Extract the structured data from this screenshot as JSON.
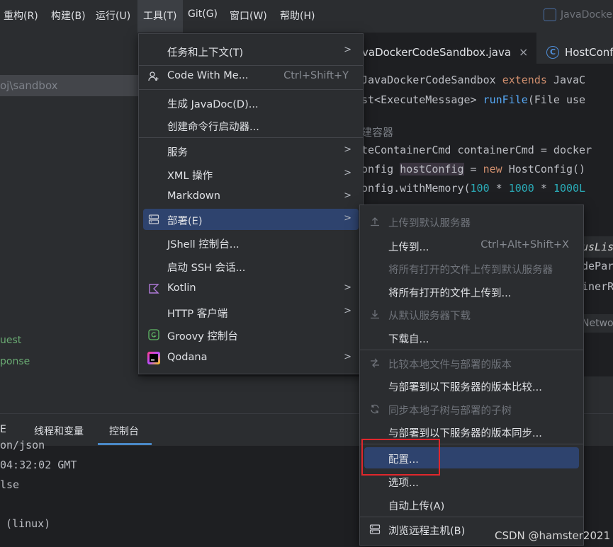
{
  "menubar": {
    "items": [
      "重构(R)",
      "构建(B)",
      "运行(U)",
      "工具(T)",
      "Git(G)",
      "窗口(W)",
      "帮助(H)"
    ],
    "window_title": "JavaDocker"
  },
  "project": {
    "path_fragment": "oj\\sandbox",
    "items": [
      "uest",
      "ponse"
    ]
  },
  "editor": {
    "tabs": [
      {
        "label": "vaDockerCodeSandbox.java",
        "close": "×",
        "active": true
      },
      {
        "label": "HostConf",
        "icon": "C"
      }
    ],
    "lines": [
      {
        "kind": "c1",
        "a": "JavaDockerCodeSandbox ",
        "b": "extends ",
        "c": "JavaC"
      },
      {
        "kind": "c2",
        "a": "st<ExecuteMessage> ",
        "b": "runFile",
        "c": "(File use"
      },
      {
        "kind": "comment",
        "a": "建容器"
      },
      {
        "kind": "plain",
        "a": "teContainerCmd containerCmd = docker"
      },
      {
        "kind": "c3",
        "a": "onfig ",
        "b": "hostConfig",
        "c": " = ",
        "d": "new ",
        "e": "HostConfig()"
      },
      {
        "kind": "c4",
        "a": "onfig.withMemory(",
        "b": "100",
        "c": " * ",
        "d": "1000",
        "e": " * ",
        "f": "1000L"
      },
      {
        "kind": "frag",
        "a": "usLis"
      },
      {
        "kind": "frag",
        "a": "dePar"
      },
      {
        "kind": "frag",
        "a": "inerR"
      },
      {
        "kind": "frag",
        "a": "Netwo"
      }
    ]
  },
  "bottom": {
    "tabs": [
      "E",
      "线程和变量",
      "控制台"
    ],
    "console": [
      "on/json",
      "04:32:02 GMT",
      "lse",
      "(linux)"
    ]
  },
  "tools_menu": {
    "items": [
      {
        "label": "任务和上下文(T)",
        "submenu": true
      },
      {
        "label": "Code With Me...",
        "shortcut": "Ctrl+Shift+Y",
        "icon": "person-plus-icon"
      },
      {
        "label": "生成 JavaDoc(D)..."
      },
      {
        "label": "创建命令行启动器..."
      },
      {
        "label": "服务",
        "submenu": true
      },
      {
        "label": "XML 操作",
        "submenu": true
      },
      {
        "label": "Markdown",
        "submenu": true
      },
      {
        "label": "部署(E)",
        "submenu": true,
        "icon": "server-icon",
        "selected": true
      },
      {
        "label": "JShell 控制台..."
      },
      {
        "label": "启动 SSH 会话..."
      },
      {
        "label": "Kotlin",
        "submenu": true,
        "icon": "kotlin-icon"
      },
      {
        "label": "HTTP 客户端",
        "submenu": true
      },
      {
        "label": "Groovy 控制台",
        "icon": "groovy-icon"
      },
      {
        "label": "Qodana",
        "submenu": true,
        "icon": "qodana-icon"
      }
    ]
  },
  "deploy_menu": {
    "items": [
      {
        "label": "上传到默认服务器",
        "disabled": true,
        "icon": "upload-icon"
      },
      {
        "label": "上传到...",
        "shortcut": "Ctrl+Alt+Shift+X"
      },
      {
        "label": "将所有打开的文件上传到默认服务器",
        "disabled": true
      },
      {
        "label": "将所有打开的文件上传到..."
      },
      {
        "label": "从默认服务器下载",
        "disabled": true,
        "icon": "download-icon"
      },
      {
        "label": "下载自..."
      },
      {
        "label": "比较本地文件与部署的版本",
        "disabled": true,
        "icon": "compare-icon"
      },
      {
        "label": "与部署到以下服务器的版本比较..."
      },
      {
        "label": "同步本地子树与部署的子树",
        "disabled": true,
        "icon": "sync-icon"
      },
      {
        "label": "与部署到以下服务器的版本同步..."
      },
      {
        "label": "配置...",
        "selected": true
      },
      {
        "label": "选项..."
      },
      {
        "label": "自动上传(A)"
      },
      {
        "label": "浏览远程主机(B)",
        "icon": "server-icon"
      }
    ]
  },
  "watermark": "CSDN @hamster2021",
  "colors": {
    "accent": "#2e436e",
    "highlight_box": "#e0272c",
    "keyword": "#cf8e6d",
    "function": "#56a8f5",
    "number": "#2aacb8"
  }
}
